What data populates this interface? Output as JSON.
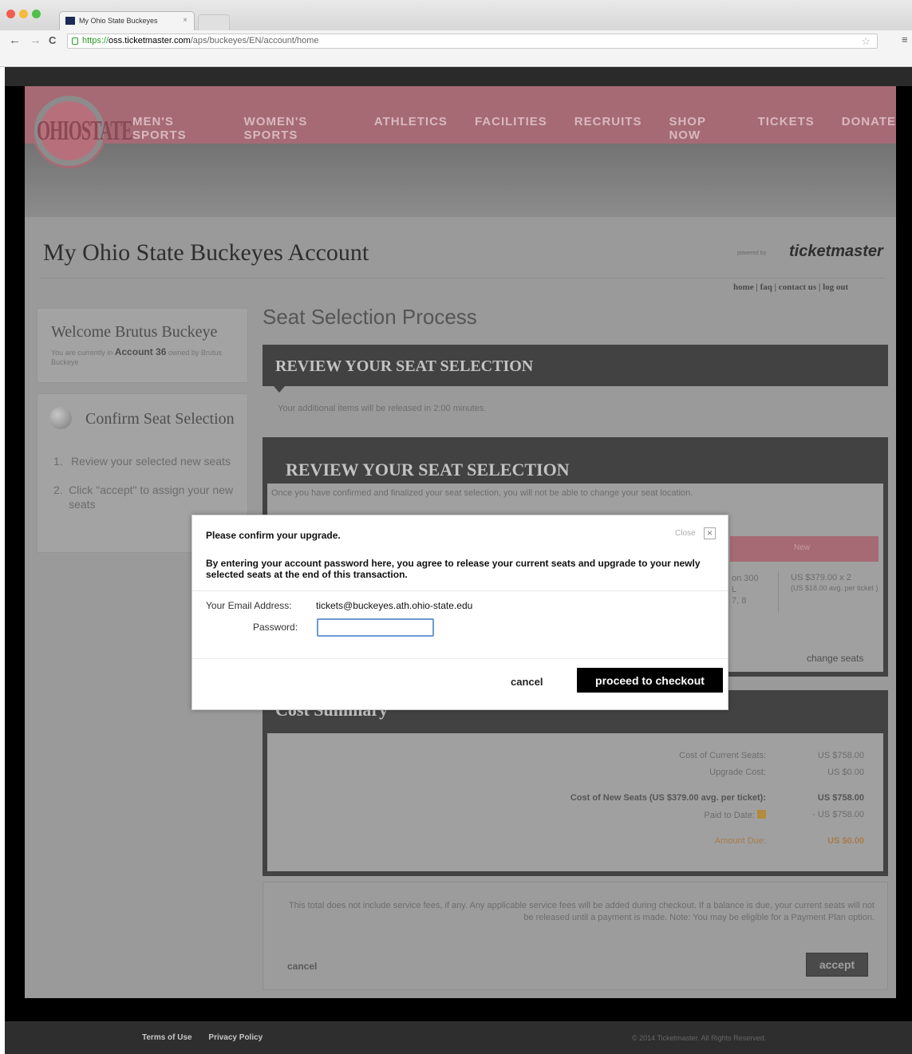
{
  "browser": {
    "tab_title": "My Ohio State Buckeyes",
    "tab_close": "×",
    "url_scheme": "https://",
    "url_host": "oss.ticketmaster.com",
    "url_path": "/aps/buckeyes/EN/account/home",
    "back": "←",
    "forward": "→",
    "reload": "C",
    "star": "☆",
    "menu": "≡",
    "traffic_colors": [
      "#f25d4f",
      "#f7b93b",
      "#4fc14b"
    ]
  },
  "site": {
    "logo_text": "OHIOSTATE",
    "nav": [
      "MEN'S SPORTS",
      "WOMEN'S SPORTS",
      "ATHLETICS",
      "FACILITIES",
      "RECRUITS",
      "SHOP NOW",
      "TICKETS",
      "DONATE"
    ],
    "account_title": "My Ohio State Buckeyes Account",
    "powered_by": "powered by",
    "brand": "ticketmaster",
    "top_links": "home | faq | contact us | log out"
  },
  "sidebar": {
    "welcome_title": "Welcome Brutus Buckeye",
    "welcome_sub_pre": "You are currently in ",
    "welcome_account": "Account 36",
    "welcome_sub_post": " owned by Brutus Buckeye",
    "steps_title": "Confirm Seat Selection",
    "steps": [
      {
        "n": "1.",
        "text": "Review your selected new seats"
      },
      {
        "n": "2.",
        "text": "Click \"accept\" to assign your new seats"
      }
    ]
  },
  "main": {
    "process_title": "Seat Selection Process",
    "review_title_1": "REVIEW YOUR SEAT SELECTION",
    "release_note": "Your additional items will be released in 2:00 minutes.",
    "review_title_2": "REVIEW YOUR SEAT SELECTION",
    "warning": "Once you have confirmed and finalized your seat selection, you will not be able to change your seat location.",
    "new_header": "New",
    "section_lines": [
      "on 300",
      "L",
      "7, 8"
    ],
    "price_line": "US $379.00 x 2",
    "price_sub": "(US $18.00 avg. per ticket )",
    "change_seats": "change seats",
    "cost_title": "Cost Summary",
    "cost_rows": [
      {
        "label": "Cost of Current Seats:",
        "value": "US $758.00"
      },
      {
        "label": "Upgrade Cost:",
        "value": "US $0.00"
      },
      {
        "label": "Cost of New Seats (US $379.00 avg. per ticket):",
        "value": "US $758.00"
      },
      {
        "label": "Paid to Date:",
        "value": "- US $758.00"
      },
      {
        "label": "Amount Due:",
        "value": "US $0.00"
      }
    ],
    "disclaimer": "This total does not include service fees, if any. Any applicable service fees will be added during checkout. If a balance is due, your current seats will not be released until a payment is made. Note: You may be eligible for a Payment Plan option.",
    "cancel": "cancel",
    "accept": "accept"
  },
  "footer": {
    "terms": "Terms of Use",
    "privacy": "Privacy Policy",
    "copyright": "© 2014 Ticketmaster. All Rights Reserved."
  },
  "modal": {
    "title": "Please confirm your upgrade.",
    "close_label": "Close",
    "close_icon": "×",
    "description": "By entering your account password here, you agree to release your current seats and upgrade to your newly selected seats at the end of this transaction.",
    "email_label": "Your Email Address:",
    "email_value": "tickets@buckeyes.ath.ohio-state.edu",
    "password_label": "Password:",
    "password_value": "",
    "cancel": "cancel",
    "proceed": "proceed to checkout"
  }
}
